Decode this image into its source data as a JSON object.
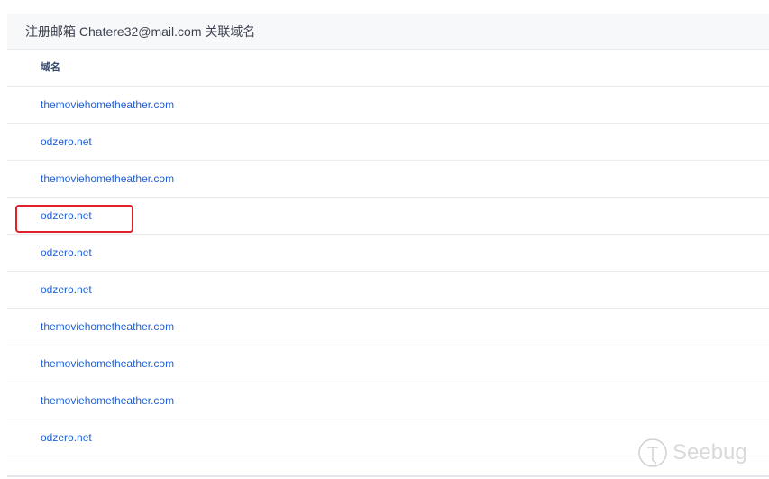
{
  "header": {
    "title": "注册邮箱 Chatere32@mail.com 关联域名"
  },
  "table": {
    "column": "域名",
    "rows": [
      "themoviehometheather.com",
      "odzero.net",
      "themoviehometheather.com",
      "odzero.net",
      "odzero.net",
      "odzero.net",
      "themoviehometheather.com",
      "themoviehometheather.com",
      "themoviehometheather.com",
      "odzero.net"
    ]
  },
  "watermark": {
    "text": "Seebug"
  },
  "colors": {
    "link": "#1f5fd6",
    "highlight": "#e0202a"
  }
}
